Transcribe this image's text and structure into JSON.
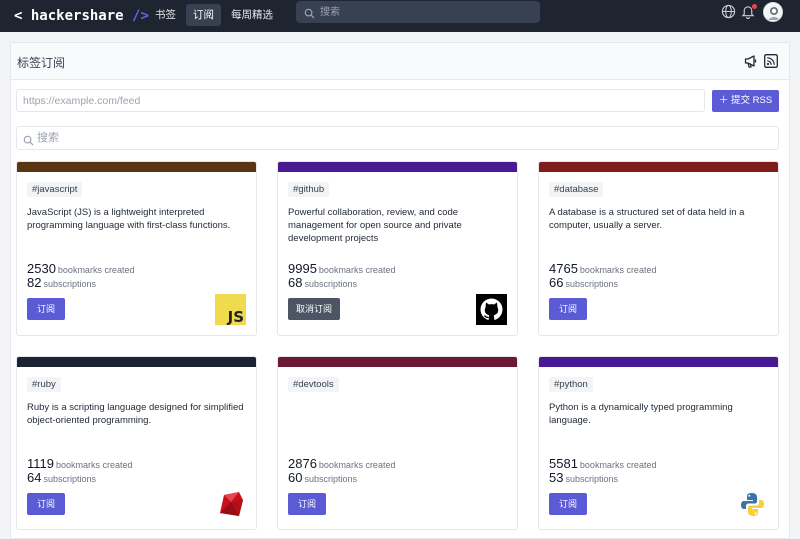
{
  "nav": {
    "logo_prefix": "<",
    "logo_text": "hackershare",
    "logo_suffix": "/>",
    "items": [
      {
        "label": "书签",
        "active": false
      },
      {
        "label": "订阅",
        "active": true
      },
      {
        "label": "每周精选",
        "active": false
      }
    ],
    "search_placeholder": "搜索",
    "icons": [
      "globe-icon",
      "bell-icon",
      "avatar"
    ]
  },
  "panel": {
    "title": "标签订阅",
    "icons": [
      "megaphone-icon",
      "rss-icon"
    ],
    "feed_placeholder": "https://example.com/feed",
    "submit_label": "＋ 提交 RSS",
    "filter_placeholder": "搜索"
  },
  "colors": {
    "accent": "#5b5bd6",
    "nav_bg": "#1e2430"
  },
  "cards": [
    {
      "tag": "#javascript",
      "description": "JavaScript (JS) is a lightweight interpreted programming language with first-class functions.",
      "bookmarks": "2530",
      "bookmarks_label": "bookmarks created",
      "subscriptions": "82",
      "subscriptions_label": "subscriptions",
      "button": "订阅",
      "subscribed": false,
      "stripe": "#5b3412",
      "logo": "javascript-logo-icon"
    },
    {
      "tag": "#github",
      "description": "Powerful collaboration, review, and code management for open source and private development projects",
      "bookmarks": "9995",
      "bookmarks_label": "bookmarks created",
      "subscriptions": "68",
      "subscriptions_label": "subscriptions",
      "button": "取消订阅",
      "subscribed": true,
      "stripe": "#4a1a95",
      "logo": "github-logo-icon"
    },
    {
      "tag": "#database",
      "description": "A database is a structured set of data held in a computer, usually a server.",
      "bookmarks": "4765",
      "bookmarks_label": "bookmarks created",
      "subscriptions": "66",
      "subscriptions_label": "subscriptions",
      "button": "订阅",
      "subscribed": false,
      "stripe": "#7f1d1d",
      "logo": ""
    },
    {
      "tag": "#ruby",
      "description": "Ruby is a scripting language designed for simplified object-oriented programming.",
      "bookmarks": "1119",
      "bookmarks_label": "bookmarks created",
      "subscriptions": "64",
      "subscriptions_label": "subscriptions",
      "button": "订阅",
      "subscribed": false,
      "stripe": "#1c2333",
      "logo": "ruby-logo-icon"
    },
    {
      "tag": "#devtools",
      "description": "",
      "bookmarks": "2876",
      "bookmarks_label": "bookmarks created",
      "subscriptions": "60",
      "subscriptions_label": "subscriptions",
      "button": "订阅",
      "subscribed": false,
      "stripe": "#6b1a36",
      "logo": ""
    },
    {
      "tag": "#python",
      "description": "Python is a dynamically typed programming language.",
      "bookmarks": "5581",
      "bookmarks_label": "bookmarks created",
      "subscriptions": "53",
      "subscriptions_label": "subscriptions",
      "button": "订阅",
      "subscribed": false,
      "stripe": "#4a1a95",
      "logo": "python-logo-icon"
    }
  ]
}
